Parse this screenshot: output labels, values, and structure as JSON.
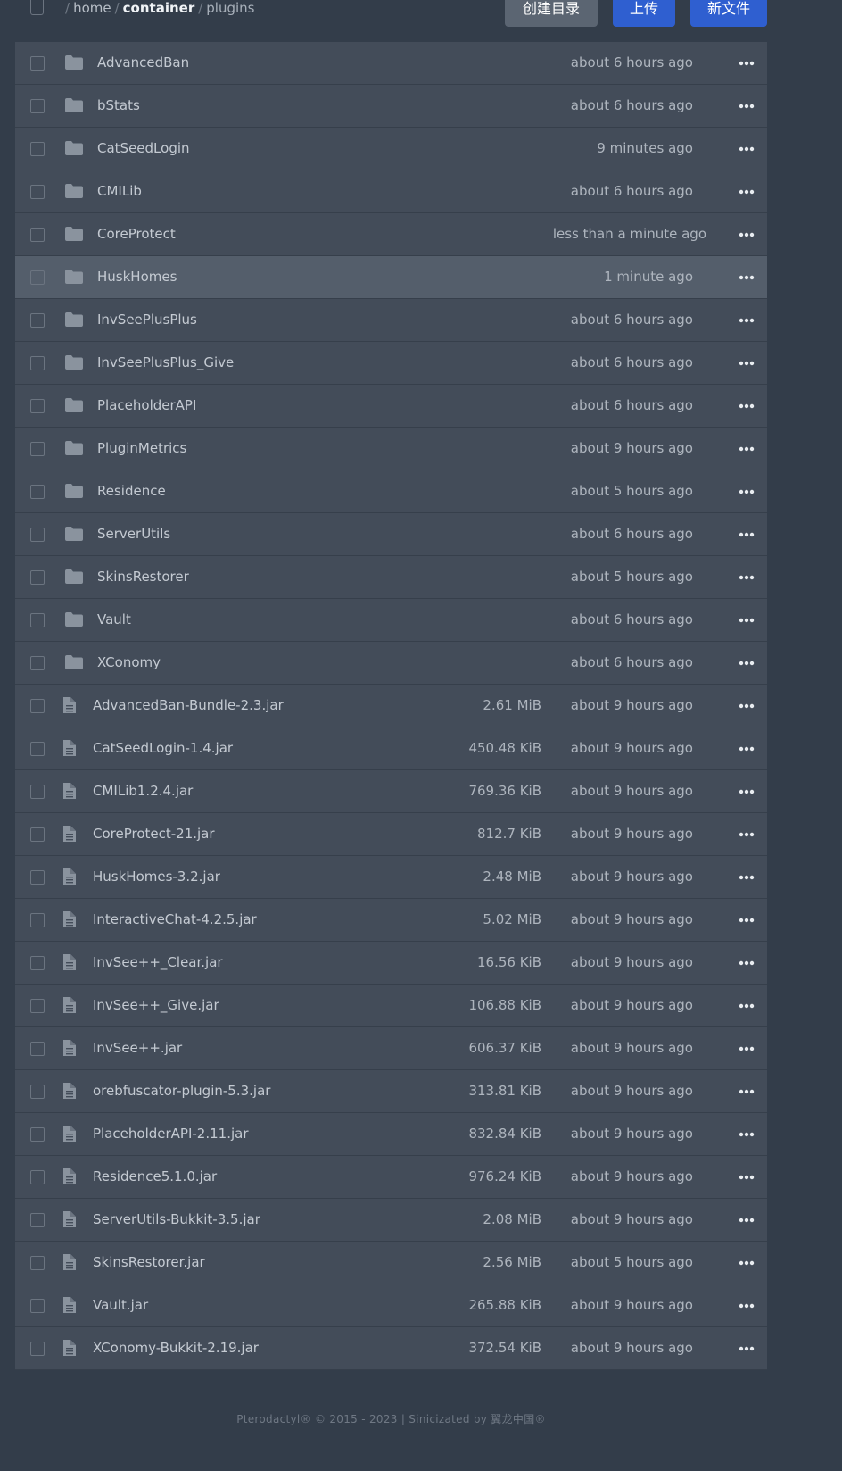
{
  "breadcrumb": {
    "sep": "/",
    "items": [
      "home",
      "container",
      "plugins"
    ]
  },
  "toolbar": {
    "create_dir_label": "创建目录",
    "upload_label": "上传",
    "new_file_label": "新文件"
  },
  "icons": {
    "folder": "folder-icon",
    "file": "file-icon",
    "more": "more-options-icon"
  },
  "colors": {
    "accent": "#2f5fd0",
    "row_bg": "#434c59",
    "row_highlight": "#545e6b",
    "page_bg": "#333d4a"
  },
  "files": [
    {
      "type": "folder",
      "name": "AdvancedBan",
      "size": "",
      "modified": "about 6 hours ago"
    },
    {
      "type": "folder",
      "name": "bStats",
      "size": "",
      "modified": "about 6 hours ago"
    },
    {
      "type": "folder",
      "name": "CatSeedLogin",
      "size": "",
      "modified": "9 minutes ago"
    },
    {
      "type": "folder",
      "name": "CMILib",
      "size": "",
      "modified": "about 6 hours ago"
    },
    {
      "type": "folder",
      "name": "CoreProtect",
      "size": "",
      "modified": "less than a minute ago"
    },
    {
      "type": "folder",
      "name": "HuskHomes",
      "size": "",
      "modified": "1 minute ago",
      "hovered": true
    },
    {
      "type": "folder",
      "name": "InvSeePlusPlus",
      "size": "",
      "modified": "about 6 hours ago"
    },
    {
      "type": "folder",
      "name": "InvSeePlusPlus_Give",
      "size": "",
      "modified": "about 6 hours ago"
    },
    {
      "type": "folder",
      "name": "PlaceholderAPI",
      "size": "",
      "modified": "about 6 hours ago"
    },
    {
      "type": "folder",
      "name": "PluginMetrics",
      "size": "",
      "modified": "about 9 hours ago"
    },
    {
      "type": "folder",
      "name": "Residence",
      "size": "",
      "modified": "about 5 hours ago"
    },
    {
      "type": "folder",
      "name": "ServerUtils",
      "size": "",
      "modified": "about 6 hours ago"
    },
    {
      "type": "folder",
      "name": "SkinsRestorer",
      "size": "",
      "modified": "about 5 hours ago"
    },
    {
      "type": "folder",
      "name": "Vault",
      "size": "",
      "modified": "about 6 hours ago"
    },
    {
      "type": "folder",
      "name": "XConomy",
      "size": "",
      "modified": "about 6 hours ago"
    },
    {
      "type": "file",
      "name": "AdvancedBan-Bundle-2.3.jar",
      "size": "2.61 MiB",
      "modified": "about 9 hours ago"
    },
    {
      "type": "file",
      "name": "CatSeedLogin-1.4.jar",
      "size": "450.48 KiB",
      "modified": "about 9 hours ago"
    },
    {
      "type": "file",
      "name": "CMILib1.2.4.jar",
      "size": "769.36 KiB",
      "modified": "about 9 hours ago"
    },
    {
      "type": "file",
      "name": "CoreProtect-21.jar",
      "size": "812.7 KiB",
      "modified": "about 9 hours ago"
    },
    {
      "type": "file",
      "name": "HuskHomes-3.2.jar",
      "size": "2.48 MiB",
      "modified": "about 9 hours ago"
    },
    {
      "type": "file",
      "name": "InteractiveChat-4.2.5.jar",
      "size": "5.02 MiB",
      "modified": "about 9 hours ago"
    },
    {
      "type": "file",
      "name": "InvSee++_Clear.jar",
      "size": "16.56 KiB",
      "modified": "about 9 hours ago"
    },
    {
      "type": "file",
      "name": "InvSee++_Give.jar",
      "size": "106.88 KiB",
      "modified": "about 9 hours ago"
    },
    {
      "type": "file",
      "name": "InvSee++.jar",
      "size": "606.37 KiB",
      "modified": "about 9 hours ago"
    },
    {
      "type": "file",
      "name": "orebfuscator-plugin-5.3.jar",
      "size": "313.81 KiB",
      "modified": "about 9 hours ago"
    },
    {
      "type": "file",
      "name": "PlaceholderAPI-2.11.jar",
      "size": "832.84 KiB",
      "modified": "about 9 hours ago"
    },
    {
      "type": "file",
      "name": "Residence5.1.0.jar",
      "size": "976.24 KiB",
      "modified": "about 9 hours ago"
    },
    {
      "type": "file",
      "name": "ServerUtils-Bukkit-3.5.jar",
      "size": "2.08 MiB",
      "modified": "about 9 hours ago"
    },
    {
      "type": "file",
      "name": "SkinsRestorer.jar",
      "size": "2.56 MiB",
      "modified": "about 5 hours ago"
    },
    {
      "type": "file",
      "name": "Vault.jar",
      "size": "265.88 KiB",
      "modified": "about 9 hours ago"
    },
    {
      "type": "file",
      "name": "XConomy-Bukkit-2.19.jar",
      "size": "372.54 KiB",
      "modified": "about 9 hours ago"
    }
  ],
  "footer": {
    "text": "Pterodactyl® © 2015 - 2023 | Sinicizated by 翼龙中国®"
  }
}
